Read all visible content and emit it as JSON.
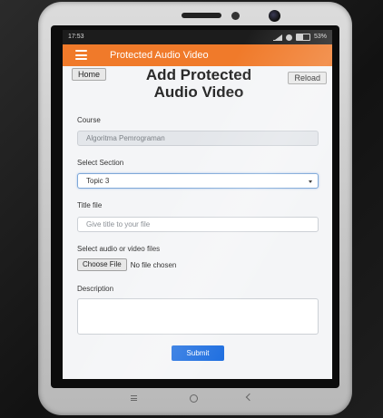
{
  "status_bar": {
    "time": "17:53",
    "battery": "53%"
  },
  "app_bar": {
    "title": "Protected Audio Video",
    "menu_icon": "hamburger-menu-icon"
  },
  "buttons": {
    "home": "Home",
    "reload": "Reload",
    "submit": "Submit",
    "choose_file": "Choose File"
  },
  "page": {
    "heading_line1": "Add Protected",
    "heading_line2": "Audio Video"
  },
  "form": {
    "course_label": "Course",
    "course_value": "Algoritma Pemrograman",
    "section_label": "Select Section",
    "section_value": "Topic 3",
    "title_label": "Title file",
    "title_placeholder": "Give title to your file",
    "files_label": "Select audio or video files",
    "file_status": "No file chosen",
    "description_label": "Description"
  },
  "colors": {
    "app_bar": "#f07a2a",
    "submit": "#1f6fe0"
  }
}
